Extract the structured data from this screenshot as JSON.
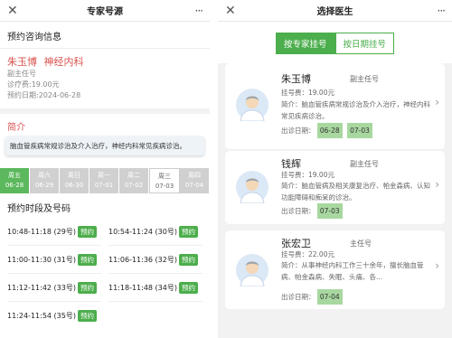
{
  "left": {
    "header": {
      "close": "✕",
      "title": "专家号源",
      "more": "···"
    },
    "section_title": "预约咨询信息",
    "doctor": {
      "name": "朱玉博",
      "dept": "神经内科",
      "rank": "副主任号",
      "fee": "诊疗费:19.00元",
      "date": "预约日期:2024-06-28"
    },
    "intro_title": "简介",
    "intro_text": "脑血管疾病常规诊治及介入治疗，神经内科常见疾病诊治。",
    "dates": [
      {
        "weekday": "周五",
        "date": "06-28",
        "state": "active"
      },
      {
        "weekday": "周六",
        "date": "06-29",
        "state": ""
      },
      {
        "weekday": "周日",
        "date": "06-30",
        "state": ""
      },
      {
        "weekday": "周一",
        "date": "07-01",
        "state": ""
      },
      {
        "weekday": "周二",
        "date": "07-02",
        "state": ""
      },
      {
        "weekday": "周三",
        "date": "07-03",
        "state": "selected"
      },
      {
        "weekday": "周四",
        "date": "07-04",
        "state": ""
      }
    ],
    "slots_title": "预约时段及号码",
    "slots": [
      {
        "time": "10:48-11:18 (29号)",
        "button": "预约"
      },
      {
        "time": "10:54-11:24 (30号)",
        "button": "预约"
      },
      {
        "time": "11:00-11:30 (31号)",
        "button": "预约"
      },
      {
        "time": "11:06-11:36 (32号)",
        "button": "预约"
      },
      {
        "time": "11:12-11:42 (33号)",
        "button": "预约"
      },
      {
        "time": "11:18-11:48 (34号)",
        "button": "预约"
      },
      {
        "time": "11:24-11:54 (35号)",
        "button": "预约"
      }
    ]
  },
  "right": {
    "header": {
      "close": "✕",
      "title": "选择医生",
      "more": "···"
    },
    "tabs": {
      "expert": "按专家挂号",
      "date": "按日期挂号"
    },
    "doctors": [
      {
        "name": "朱玉博",
        "rank": "副主任号",
        "fee": "挂号费：19.00元",
        "intro": "简介：脑血管疾病常规诊治及介入治疗，神经内科常见疾病诊治。",
        "dates_label": "出诊日期：",
        "dates": [
          "06-28",
          "07-03"
        ]
      },
      {
        "name": "钱辉",
        "rank": "副主任号",
        "fee": "挂号费：19.00元",
        "intro": "简介：脑血管病及相关康复治疗、帕金森病、认知功能障碍和痴呆的诊治。",
        "dates_label": "出诊日期：",
        "dates": [
          "07-03"
        ]
      },
      {
        "name": "张宏卫",
        "rank": "主任号",
        "fee": "挂号费：22.00元",
        "intro": "简介：从事神经内科工作三十余年，擅长脑血管病、帕金森病、失眠、头痛、各...",
        "dates_label": "出诊日期：",
        "dates": [
          "07-04"
        ]
      }
    ],
    "chevron": "›"
  }
}
